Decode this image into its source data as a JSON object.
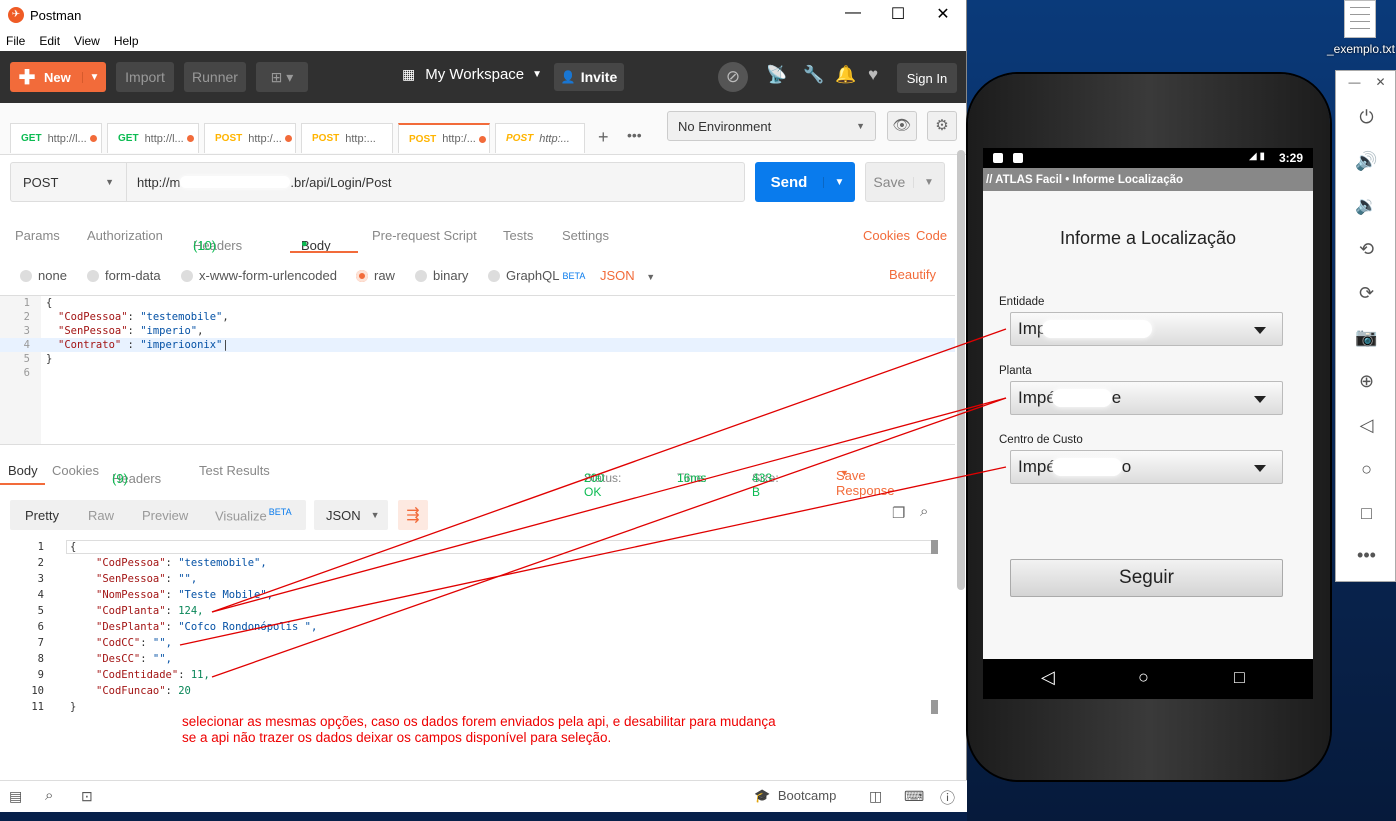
{
  "desktop": {
    "file_label": "_exemplo.txt"
  },
  "window": {
    "title": "Postman",
    "min": "—",
    "max": "☐",
    "close": "✕"
  },
  "menu": [
    "File",
    "Edit",
    "View",
    "Help"
  ],
  "toolbar": {
    "new_label": "New",
    "import_label": "Import",
    "runner_label": "Runner",
    "workspace_label": "My Workspace",
    "invite_label": "Invite",
    "signin_label": "Sign In"
  },
  "tabs": [
    {
      "method": "GET",
      "label": "http://l...",
      "method_color": "#0cbb52"
    },
    {
      "method": "GET",
      "label": "http://l...",
      "method_color": "#0cbb52"
    },
    {
      "method": "POST",
      "label": "http:/...",
      "method_color": "#ffb400"
    },
    {
      "method": "POST",
      "label": "http:...",
      "method_color": "#ffb400"
    },
    {
      "method": "POST",
      "label": "http:/...",
      "method_color": "#ffb400"
    },
    {
      "method": "POST",
      "label": "http:...",
      "method_color": "#ffb400"
    }
  ],
  "environment": {
    "selected": "No Environment"
  },
  "request": {
    "method": "POST",
    "url_prefix": "http://m",
    "url_suffix": ".br/api/Login/Post",
    "send_label": "Send",
    "save_label": "Save"
  },
  "request_tabs": {
    "params": "Params",
    "authorization": "Authorization",
    "headers": "Headers",
    "headers_count": "(10)",
    "body": "Body",
    "prerequest": "Pre-request Script",
    "tests": "Tests",
    "settings": "Settings",
    "cookies": "Cookies",
    "code": "Code"
  },
  "body_modes": {
    "none": "none",
    "form_data": "form-data",
    "urlencoded": "x-www-form-urlencoded",
    "raw": "raw",
    "binary": "binary",
    "graphql": "GraphQL",
    "beta": "BETA",
    "format": "JSON",
    "beautify": "Beautify"
  },
  "request_body": {
    "line_numbers": [
      "1",
      "2",
      "3",
      "4",
      "5",
      "6"
    ],
    "open": "{",
    "k1": "\"CodPessoa\"",
    "v1": "\"testemobile\"",
    "k2": "\"SenPessoa\"",
    "v2": "\"imperio\"",
    "k3": "\"Contrato\"",
    "v3": "\"imperioonix\"",
    "close": "}"
  },
  "response_tabs": {
    "body": "Body",
    "cookies": "Cookies",
    "headers": "Headers",
    "headers_count": "(9)",
    "test_results": "Test Results",
    "status_label": "Status:",
    "status_value": "200 OK",
    "time_label": "Time:",
    "time_value": "16ms",
    "size_label": "Size:",
    "size_value": "433 B",
    "save_response": "Save Response"
  },
  "response_toolbar": {
    "pretty": "Pretty",
    "raw": "Raw",
    "preview": "Preview",
    "visualize": "Visualize",
    "beta": "BETA",
    "format": "JSON"
  },
  "response_body": {
    "line_numbers": [
      "1",
      "2",
      "3",
      "4",
      "5",
      "6",
      "7",
      "8",
      "9",
      "10",
      "11"
    ],
    "lines": [
      {
        "k": "",
        "v": "",
        "raw": "{"
      },
      {
        "k": "\"CodPessoa\"",
        "v": "\"testemobile\","
      },
      {
        "k": "\"SenPessoa\"",
        "v": "\"\","
      },
      {
        "k": "\"NomPessoa\"",
        "v": "\"Teste Mobile\","
      },
      {
        "k": "\"CodPlanta\"",
        "v": "124,"
      },
      {
        "k": "\"DesPlanta\"",
        "v": "\"Cofco Rondonópolis \","
      },
      {
        "k": "\"CodCC\"",
        "v": "\"\","
      },
      {
        "k": "\"DesCC\"",
        "v": "\"\","
      },
      {
        "k": "\"CodEntidade\"",
        "v": "11,"
      },
      {
        "k": "\"CodFuncao\"",
        "v": "20"
      },
      {
        "k": "",
        "v": "",
        "raw": "}"
      }
    ]
  },
  "annotation": {
    "line1": "selecionar as mesmas opções, caso os dados forem enviados pela api, e desabilitar para mudança",
    "line2": "se a api não trazer os dados deixar os campos disponível para seleção.",
    "color": "#e00000"
  },
  "statusbar": {
    "bootcamp": "Bootcamp"
  },
  "phone": {
    "time": "3:29",
    "app_title": "// ATLAS Facil • Informe Localização",
    "heading": "Informe a Localização",
    "entidade_label": "Entidade",
    "entidade_value": "Imp",
    "planta_label": "Planta",
    "planta_value": "Impé",
    "planta_suffix": "e",
    "cc_label": "Centro de Custo",
    "cc_value": "Impé",
    "cc_suffix": "o",
    "seguir_label": "Seguir"
  }
}
